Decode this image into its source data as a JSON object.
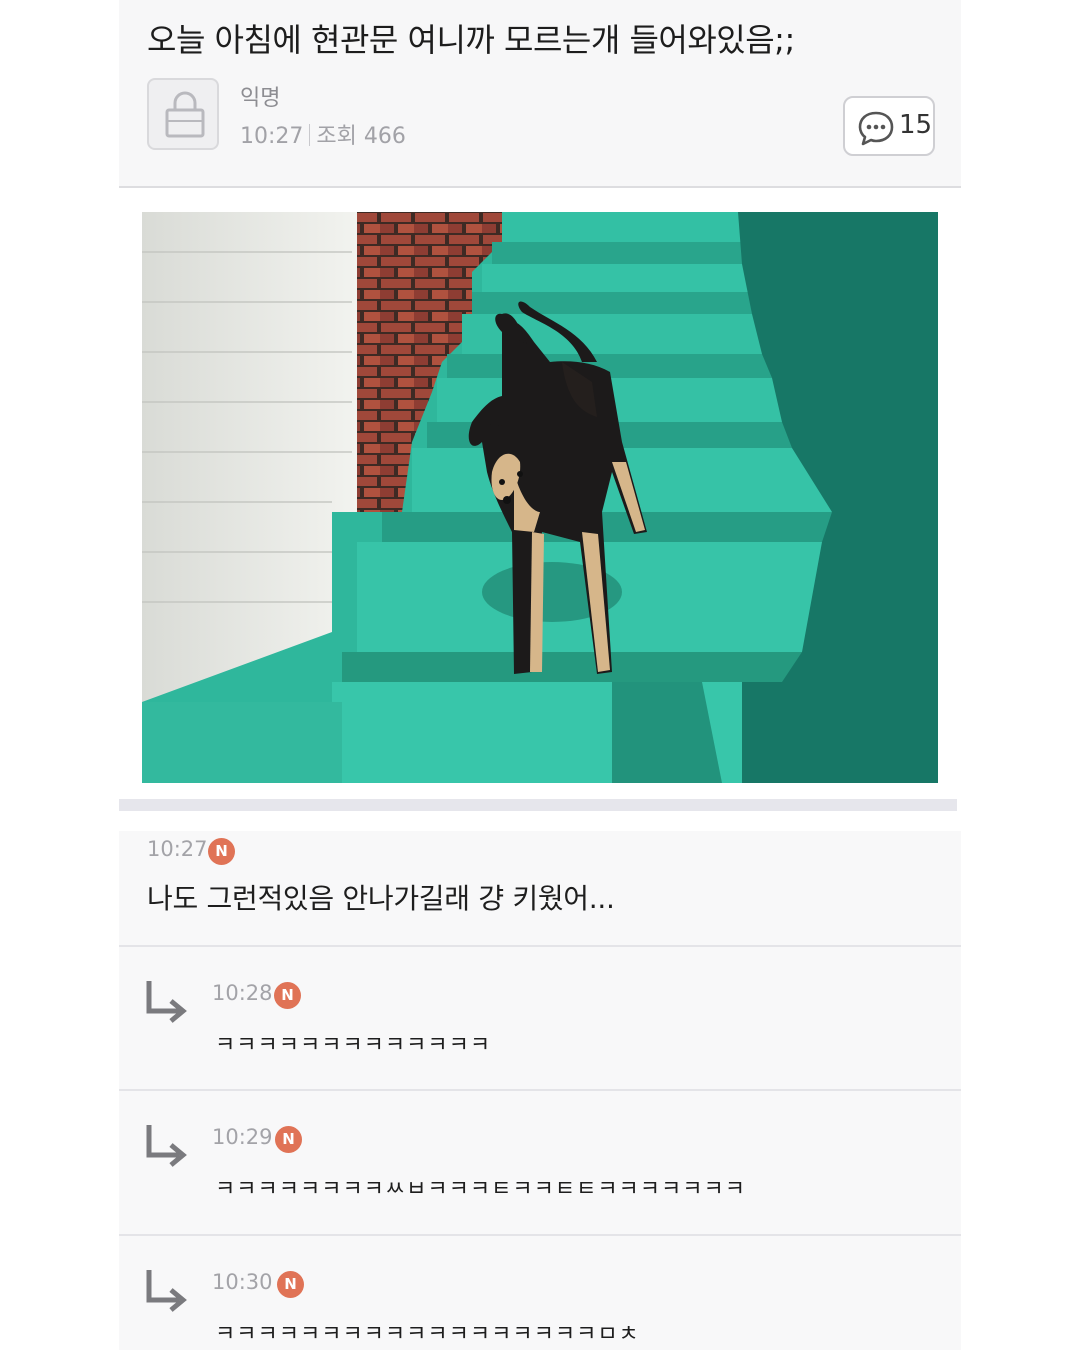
{
  "post": {
    "title": "오늘 아침에 현관문 여니까 모르는개 들어와있음;;",
    "author": "익명",
    "time": "10:27",
    "views_label": "조회 466",
    "comment_count": "15"
  },
  "icons": {
    "avatar": "lock-icon",
    "comments": "speech-bubble-icon",
    "reply": "reply-arrow-icon"
  },
  "colors": {
    "new_badge": "#e07356",
    "header_bg": "#f7f7f8",
    "stairs": "#2ab096"
  },
  "new_badge_label": "N",
  "comments": [
    {
      "time": "10:27",
      "text": "나도 그런적있음 안나가길래 걍 키웠어...",
      "is_reply": false
    },
    {
      "time": "10:28",
      "text": "ㅋㅋㅋㅋㅋㅋㅋㅋㅋㅋㅋㅋㅋ",
      "is_reply": true
    },
    {
      "time": "10:29",
      "text": "ㅋㅋㅋㅋㅋㅋㅋㅋㅆㅂㅋㅋㅋㅌㅋㅋㅌㅌㅋㅋㅋㅋㅋㅋㅋ",
      "is_reply": true
    },
    {
      "time": "10:30",
      "text": "ㅋㅋㅋㅋㅋㅋㅋㅋㅋㅋㅋㅋㅋㅋㅋㅋㅋㅋㅁㅊ",
      "is_reply": true
    }
  ]
}
